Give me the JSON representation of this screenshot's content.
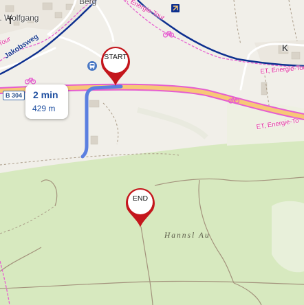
{
  "places": {
    "berg": "Berg",
    "st_wolfgang": "St. Wolfgang",
    "k_partial": "K"
  },
  "roads": {
    "jakobsweg": "Jakobsweg",
    "b304": "B 304"
  },
  "trails": {
    "et_top": "ET, Energie-Tour",
    "et_right": "ET, Energie-Tour",
    "et_right_short": "ET, Energie-To",
    "tour_left": "Tour"
  },
  "areas": {
    "hannsl_au": "Hannsl Au"
  },
  "markers": {
    "start": "START",
    "end": "END"
  },
  "route": {
    "time": "2 min",
    "distance": "429 m",
    "color": "#5b7fe0"
  },
  "icons": {
    "bus": "bus-stop-icon",
    "bike": "bicycle-icon",
    "church": "church-icon",
    "station": "train-station-icon"
  },
  "colors": {
    "forest": "#d7e9bf",
    "land": "#f1efe9",
    "main_road": "#f7c877",
    "highlight_road": "#e65ed0",
    "railway": "#0d2f8f",
    "pin": "#c4161c"
  }
}
